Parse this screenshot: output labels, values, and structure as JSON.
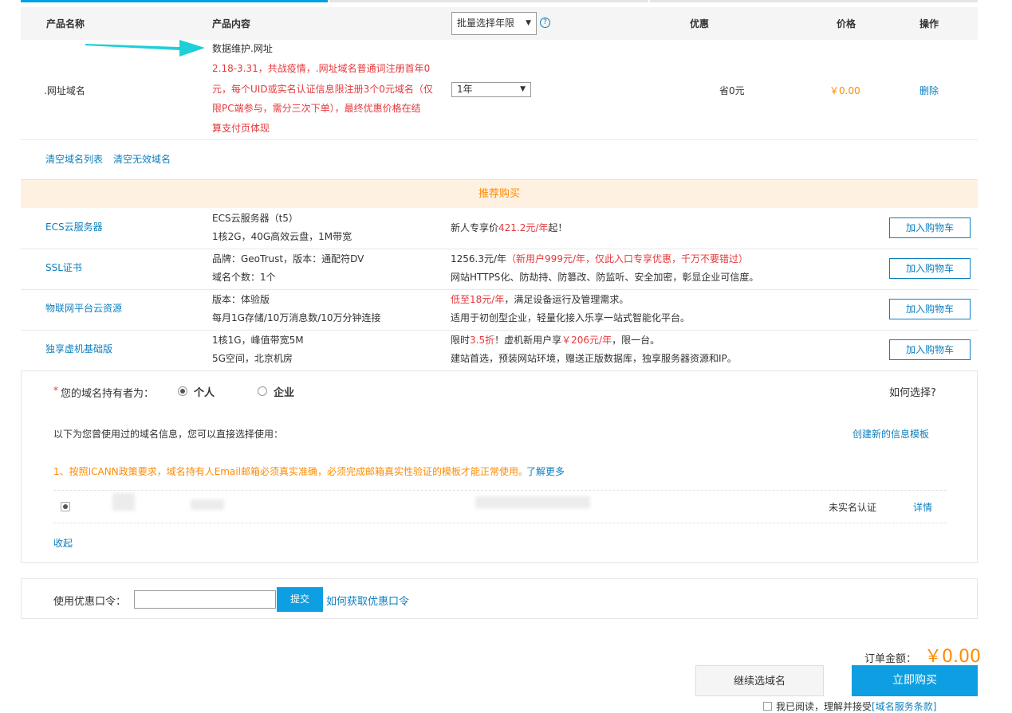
{
  "header": {
    "col_product_name": "产品名称",
    "col_product_content": "产品内容",
    "batch_year_select": "批量选择年限",
    "col_discount": "优惠",
    "col_price": "价格",
    "col_action": "操作"
  },
  "product": {
    "name": ".网址域名",
    "title": "数据维护.网址",
    "promo_lines": [
      "2.18-3.31，共战疫情，.网址域名普通词注册首年0",
      "元，每个UID或实名认证信息限注册3个0元域名（仅",
      "限PC端参与，需分三次下单），最终优惠价格在结",
      "算支付页体现"
    ],
    "year": "1年",
    "discount": "省0元",
    "price": "￥0.00",
    "delete": "删除"
  },
  "list_actions": {
    "clear_list": "清空域名列表",
    "clear_invalid": "清空无效域名"
  },
  "recommend": {
    "title": "推荐购买",
    "add_label": "加入购物车",
    "items": [
      {
        "name": "ECS云服务器",
        "spec1": "ECS云服务器（t5）",
        "spec2": "1核2G，40G高效云盘，1M带宽",
        "d1a": "新人专享价",
        "d1b": "421.2元/年",
        "d1c": "起！",
        "d2": ""
      },
      {
        "name": "SSL证书",
        "spec1": "品牌：GeoTrust，版本：通配符DV",
        "spec2": "域名个数：1个",
        "d1a": "1256.3元/年",
        "d1b": "（新用户999元/年，仅此入口专享优惠，千万不要错过）",
        "d1c": "",
        "d2": "网站HTTPS化、防劫持、防篡改、防监听、安全加密，彰显企业可信度。"
      },
      {
        "name": "物联网平台云资源",
        "spec1": "版本：体验版",
        "spec2": "每月1G存储/10万消息数/10万分钟连接",
        "d1a": "",
        "d1b": "低至18元/年",
        "d1c": "，满足设备运行及管理需求。",
        "d2": "适用于初创型企业，轻量化接入乐享一站式智能化平台。"
      },
      {
        "name": "独享虚机基础版",
        "spec1": "1核1G，峰值带宽5M",
        "spec2": "5G空间，北京机房",
        "d1a": "限时",
        "d1b": "3.5折",
        "d1c": "！虚机新用户享",
        "d1d": "￥206元/年",
        "d1e": "，限一台。",
        "d2": "建站首选，预装网站环境，赠送正版数据库，独享服务器资源和IP。"
      }
    ]
  },
  "holder": {
    "required_mark": "*",
    "label": "您的域名持有者为：",
    "option_personal": "个人",
    "option_company": "企业",
    "how_to_choose": "如何选择?",
    "used_info_text": "以下为您曾使用过的域名信息，您可以直接选择使用：",
    "create_template": "创建新的信息模板",
    "icann_notice": "1、按照ICANN政策要求，域名持有人Email邮箱必须真实准确，必须完成邮箱真实性验证的模板才能正常使用。",
    "learn_more": "了解更多",
    "status": "未实名认证",
    "detail": "详情",
    "collapse": "收起"
  },
  "coupon": {
    "label": "使用优惠口令：",
    "value": "",
    "submit": "提交",
    "how_to_get": "如何获取优惠口令"
  },
  "order": {
    "amount_label": "订单金额：",
    "amount": "￥0.00",
    "continue": "继续选域名",
    "buy_now": "立即购买",
    "agree_prefix": "我已阅读，理解并接受",
    "terms": "[域名服务条款]"
  },
  "colors": {
    "link": "#0d7fbf",
    "accent_red": "#e4393c",
    "accent_orange": "#ff8a00",
    "primary_button": "#0d9fe1",
    "recommend_bg": "#fff1e1",
    "arrow": "#1ecfd8"
  }
}
